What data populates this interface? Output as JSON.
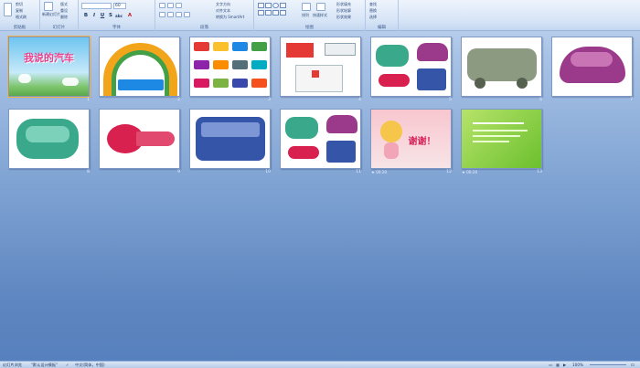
{
  "ribbon": {
    "groups": [
      {
        "label": "剪贴板",
        "items": [
          "剪切",
          "复制",
          "格式刷"
        ]
      },
      {
        "label": "幻灯片",
        "items": [
          "新建幻灯片",
          "版式",
          "重设",
          "删除"
        ]
      },
      {
        "label": "字体",
        "items": [
          "60",
          "B",
          "I",
          "U",
          "S",
          "abc",
          "A"
        ]
      },
      {
        "label": "段落",
        "items": [
          "文字方向",
          "对齐文本",
          "转换为 SmartArt"
        ]
      },
      {
        "label": "绘图",
        "items": [
          "排列",
          "快速样式",
          "形状填充",
          "形状轮廓",
          "形状效果"
        ]
      },
      {
        "label": "编辑",
        "items": [
          "查找",
          "替换",
          "选择"
        ]
      }
    ]
  },
  "slides": [
    {
      "number": "1",
      "title": "我说的汽车",
      "kind": "title",
      "bg": "#8fd0f2"
    },
    {
      "number": "2",
      "kind": "arch"
    },
    {
      "number": "3",
      "kind": "vehicles"
    },
    {
      "number": "4",
      "kind": "trucks"
    },
    {
      "number": "5",
      "kind": "cutouts"
    },
    {
      "number": "6",
      "kind": "bus-gray"
    },
    {
      "number": "7",
      "kind": "car-purple"
    },
    {
      "number": "8",
      "kind": "cake-green"
    },
    {
      "number": "9",
      "kind": "fish-red"
    },
    {
      "number": "10",
      "kind": "bus-blue"
    },
    {
      "number": "11",
      "kind": "cutouts"
    },
    {
      "number": "12",
      "title": "谢谢！",
      "kind": "thanks",
      "timing": "00:20",
      "bg": "#f7d8de"
    },
    {
      "number": "13",
      "kind": "green-text",
      "timing": "00:20",
      "bg": "#8bd03c"
    }
  ],
  "status": {
    "view": "幻灯片浏览",
    "theme": "\"默认设计模板\"",
    "language": "中文(简体，中国)",
    "zoom": "100%"
  },
  "colors": {
    "accent": "#f3b343",
    "workspace": "#6b90c7"
  }
}
